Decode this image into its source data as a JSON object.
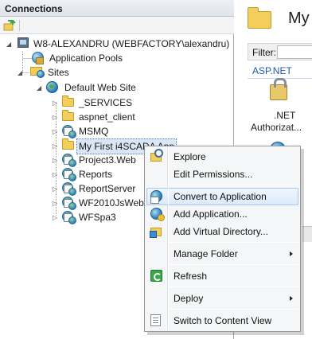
{
  "connections": {
    "title": "Connections",
    "toolbar_icons": [
      "connect-icon",
      "save-icon"
    ]
  },
  "tree": {
    "server": "W8-ALEXANDRU (WEBFACTORY\\alexandru)",
    "app_pools": "Application Pools",
    "sites": "Sites",
    "default_site": "Default Web Site",
    "children": [
      {
        "label": "_SERVICES",
        "type": "folder"
      },
      {
        "label": "aspnet_client",
        "type": "folder"
      },
      {
        "label": "MSMQ",
        "type": "application"
      },
      {
        "label": "My First i4SCADA App",
        "type": "folder",
        "selected": true
      },
      {
        "label": "Project3.Web",
        "type": "application"
      },
      {
        "label": "Reports",
        "type": "application"
      },
      {
        "label": "ReportServer",
        "type": "application"
      },
      {
        "label": "WF2010JsWebSe",
        "type": "application"
      },
      {
        "label": "WFSpa3",
        "type": "application"
      }
    ]
  },
  "right_pane": {
    "title": "My",
    "filter_label": "Filter:",
    "group": "ASP.NET",
    "item1_line1": ".NET",
    "item1_line2": "Authorizat..."
  },
  "context_menu": {
    "items": [
      {
        "label": "Explore",
        "icon": "explore-icon"
      },
      {
        "label": "Edit Permissions...",
        "icon": ""
      },
      {
        "label": "Convert to Application",
        "icon": "convert-app-icon",
        "hover": true
      },
      {
        "label": "Add Application...",
        "icon": "add-application-icon"
      },
      {
        "label": "Add Virtual Directory...",
        "icon": "add-virtual-directory-icon"
      },
      {
        "label": "Manage Folder",
        "submenu": true
      },
      {
        "label": "Refresh",
        "icon": "refresh-icon"
      },
      {
        "label": "Deploy",
        "submenu": true
      },
      {
        "label": "Switch to Content View",
        "icon": "content-view-icon"
      }
    ]
  }
}
